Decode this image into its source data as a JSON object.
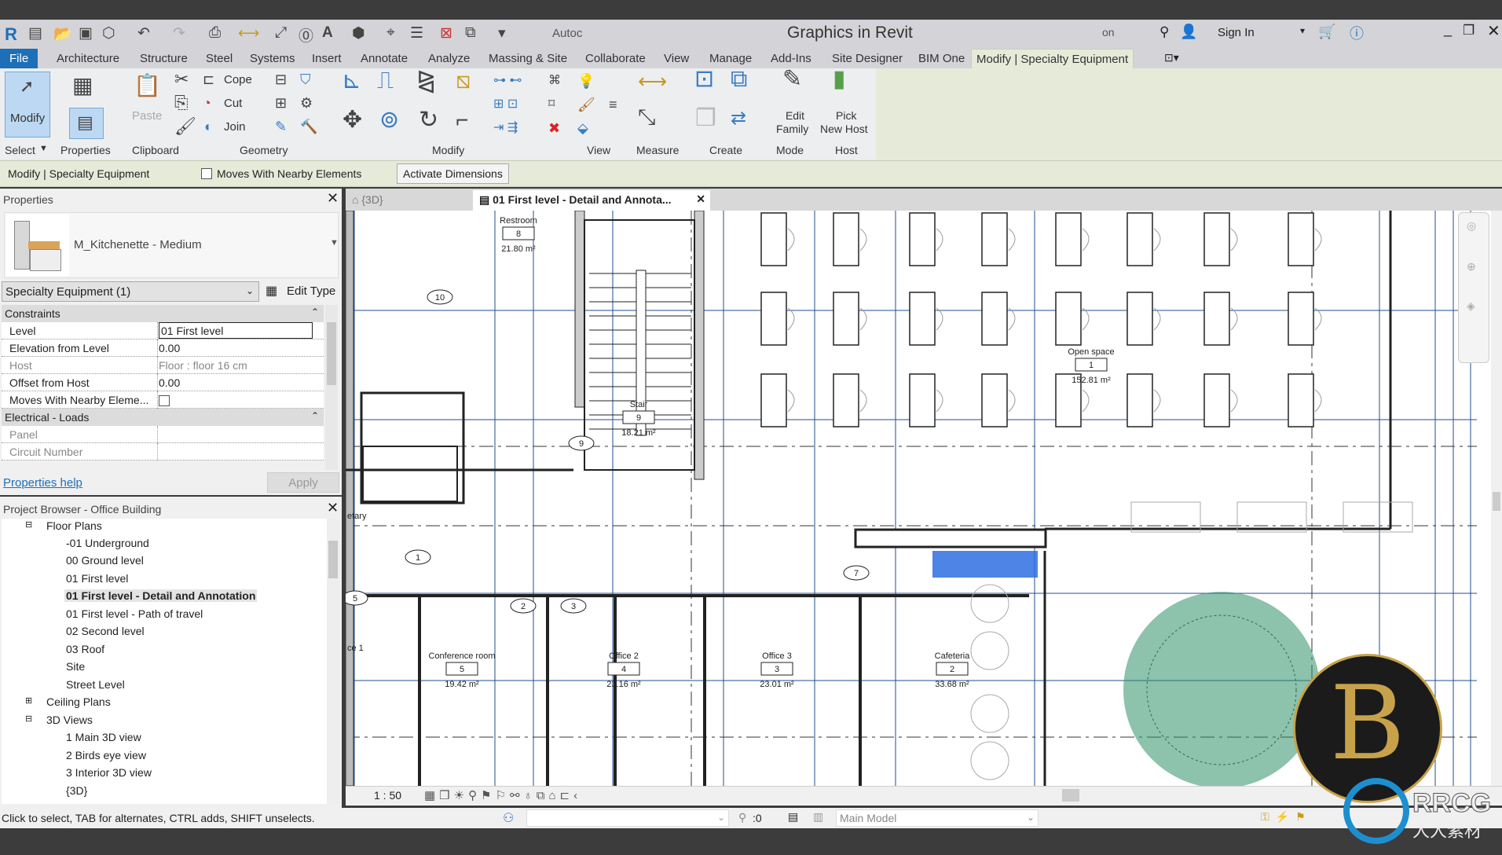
{
  "app": {
    "title": "Graphics in Revit",
    "title_prefix": "Autoc",
    "title_mid": "on",
    "sign_in": "Sign In"
  },
  "menu": {
    "tabs": [
      "File",
      "Architecture",
      "Structure",
      "Steel",
      "Systems",
      "Insert",
      "Annotate",
      "Analyze",
      "Massing & Site",
      "Collaborate",
      "View",
      "Manage",
      "Add-Ins",
      "Site Designer",
      "BIM One",
      "Modify | Specialty Equipment"
    ],
    "active": "Modify | Specialty Equipment"
  },
  "ribbon": {
    "modify_btn": "Modify",
    "paste_btn": "Paste",
    "cope": "Cope",
    "cut": "Cut",
    "join": "Join",
    "edit_family": [
      "Edit",
      "Family"
    ],
    "pick_host": [
      "Pick",
      "New Host"
    ],
    "groups": [
      "Select",
      "Properties",
      "Clipboard",
      "Geometry",
      "Modify",
      "View",
      "Measure",
      "Create",
      "Mode",
      "Host"
    ]
  },
  "options_bar": {
    "context": "Modify | Specialty Equipment",
    "moves_with": "Moves With Nearby Elements",
    "moves_with_checked": false,
    "activate_dimensions": "Activate Dimensions"
  },
  "properties": {
    "title": "Properties",
    "type_name": "M_Kitchenette - Medium",
    "selector": "Specialty Equipment (1)",
    "edit_type": "Edit Type",
    "sections": [
      {
        "name": "Constraints",
        "rows": [
          {
            "key": "Level",
            "value": "01 First level"
          },
          {
            "key": "Elevation from Level",
            "value": "0.00"
          },
          {
            "key": "Host",
            "value": "Floor : floor 16 cm",
            "disabled": true
          },
          {
            "key": "Offset from Host",
            "value": "0.00"
          },
          {
            "key": "Moves With Nearby Eleme...",
            "value": "",
            "checkbox": false
          }
        ]
      },
      {
        "name": "Electrical - Loads",
        "rows": [
          {
            "key": "Panel",
            "value": "",
            "disabled": true
          },
          {
            "key": "Circuit Number",
            "value": "",
            "disabled": true
          }
        ]
      }
    ],
    "help": "Properties help",
    "apply": "Apply"
  },
  "browser": {
    "title": "Project Browser - Office Building",
    "floor_plans": "Floor Plans",
    "floor_items": [
      "-01 Underground",
      "00 Ground level",
      "01 First level",
      "01 First level - Detail and Annotation",
      "01 First level - Path of travel",
      "02 Second level",
      "03 Roof",
      "Site",
      "Street Level"
    ],
    "selected": "01 First level - Detail and Annotation",
    "ceiling_plans": "Ceiling Plans",
    "views_3d": "3D Views",
    "items_3d": [
      "1 Main 3D view",
      "2 Birds eye view",
      "3 Interior 3D view",
      "{3D}"
    ]
  },
  "view_tabs": [
    {
      "label": "{3D}"
    },
    {
      "label": "01 First level - Detail and Annota...",
      "active": true
    }
  ],
  "drawing": {
    "rooms": [
      {
        "name": "Restroom",
        "number": "8",
        "area": "21.80 m²"
      },
      {
        "name": "Stair",
        "number": "9",
        "area": "18.21 m²"
      },
      {
        "name": "Open space",
        "number": "1",
        "area": "152.81 m²"
      },
      {
        "name": "Conference room",
        "number": "5",
        "area": "19.42 m²"
      },
      {
        "name": "Office 2",
        "number": "4",
        "area": "23.16 m²"
      },
      {
        "name": "Office 3",
        "number": "3",
        "area": "23.01 m²"
      },
      {
        "name": "Cafeteria",
        "number": "2",
        "area": "33.68 m²"
      }
    ],
    "partial_labels": [
      "etary",
      "ce 1"
    ],
    "door_tags": [
      "1",
      "2",
      "3",
      "5",
      "7",
      "9",
      "10"
    ],
    "selection_color": "#2f6fe0"
  },
  "view_bar": {
    "scale": "1 : 50"
  },
  "status": {
    "hint": "Click to select, TAB for alternates, CTRL adds, SHIFT unselects.",
    "filter": ":0",
    "model": "Main Model"
  },
  "watermark": {
    "text": "RRCG",
    "subtext": "人人素材"
  }
}
